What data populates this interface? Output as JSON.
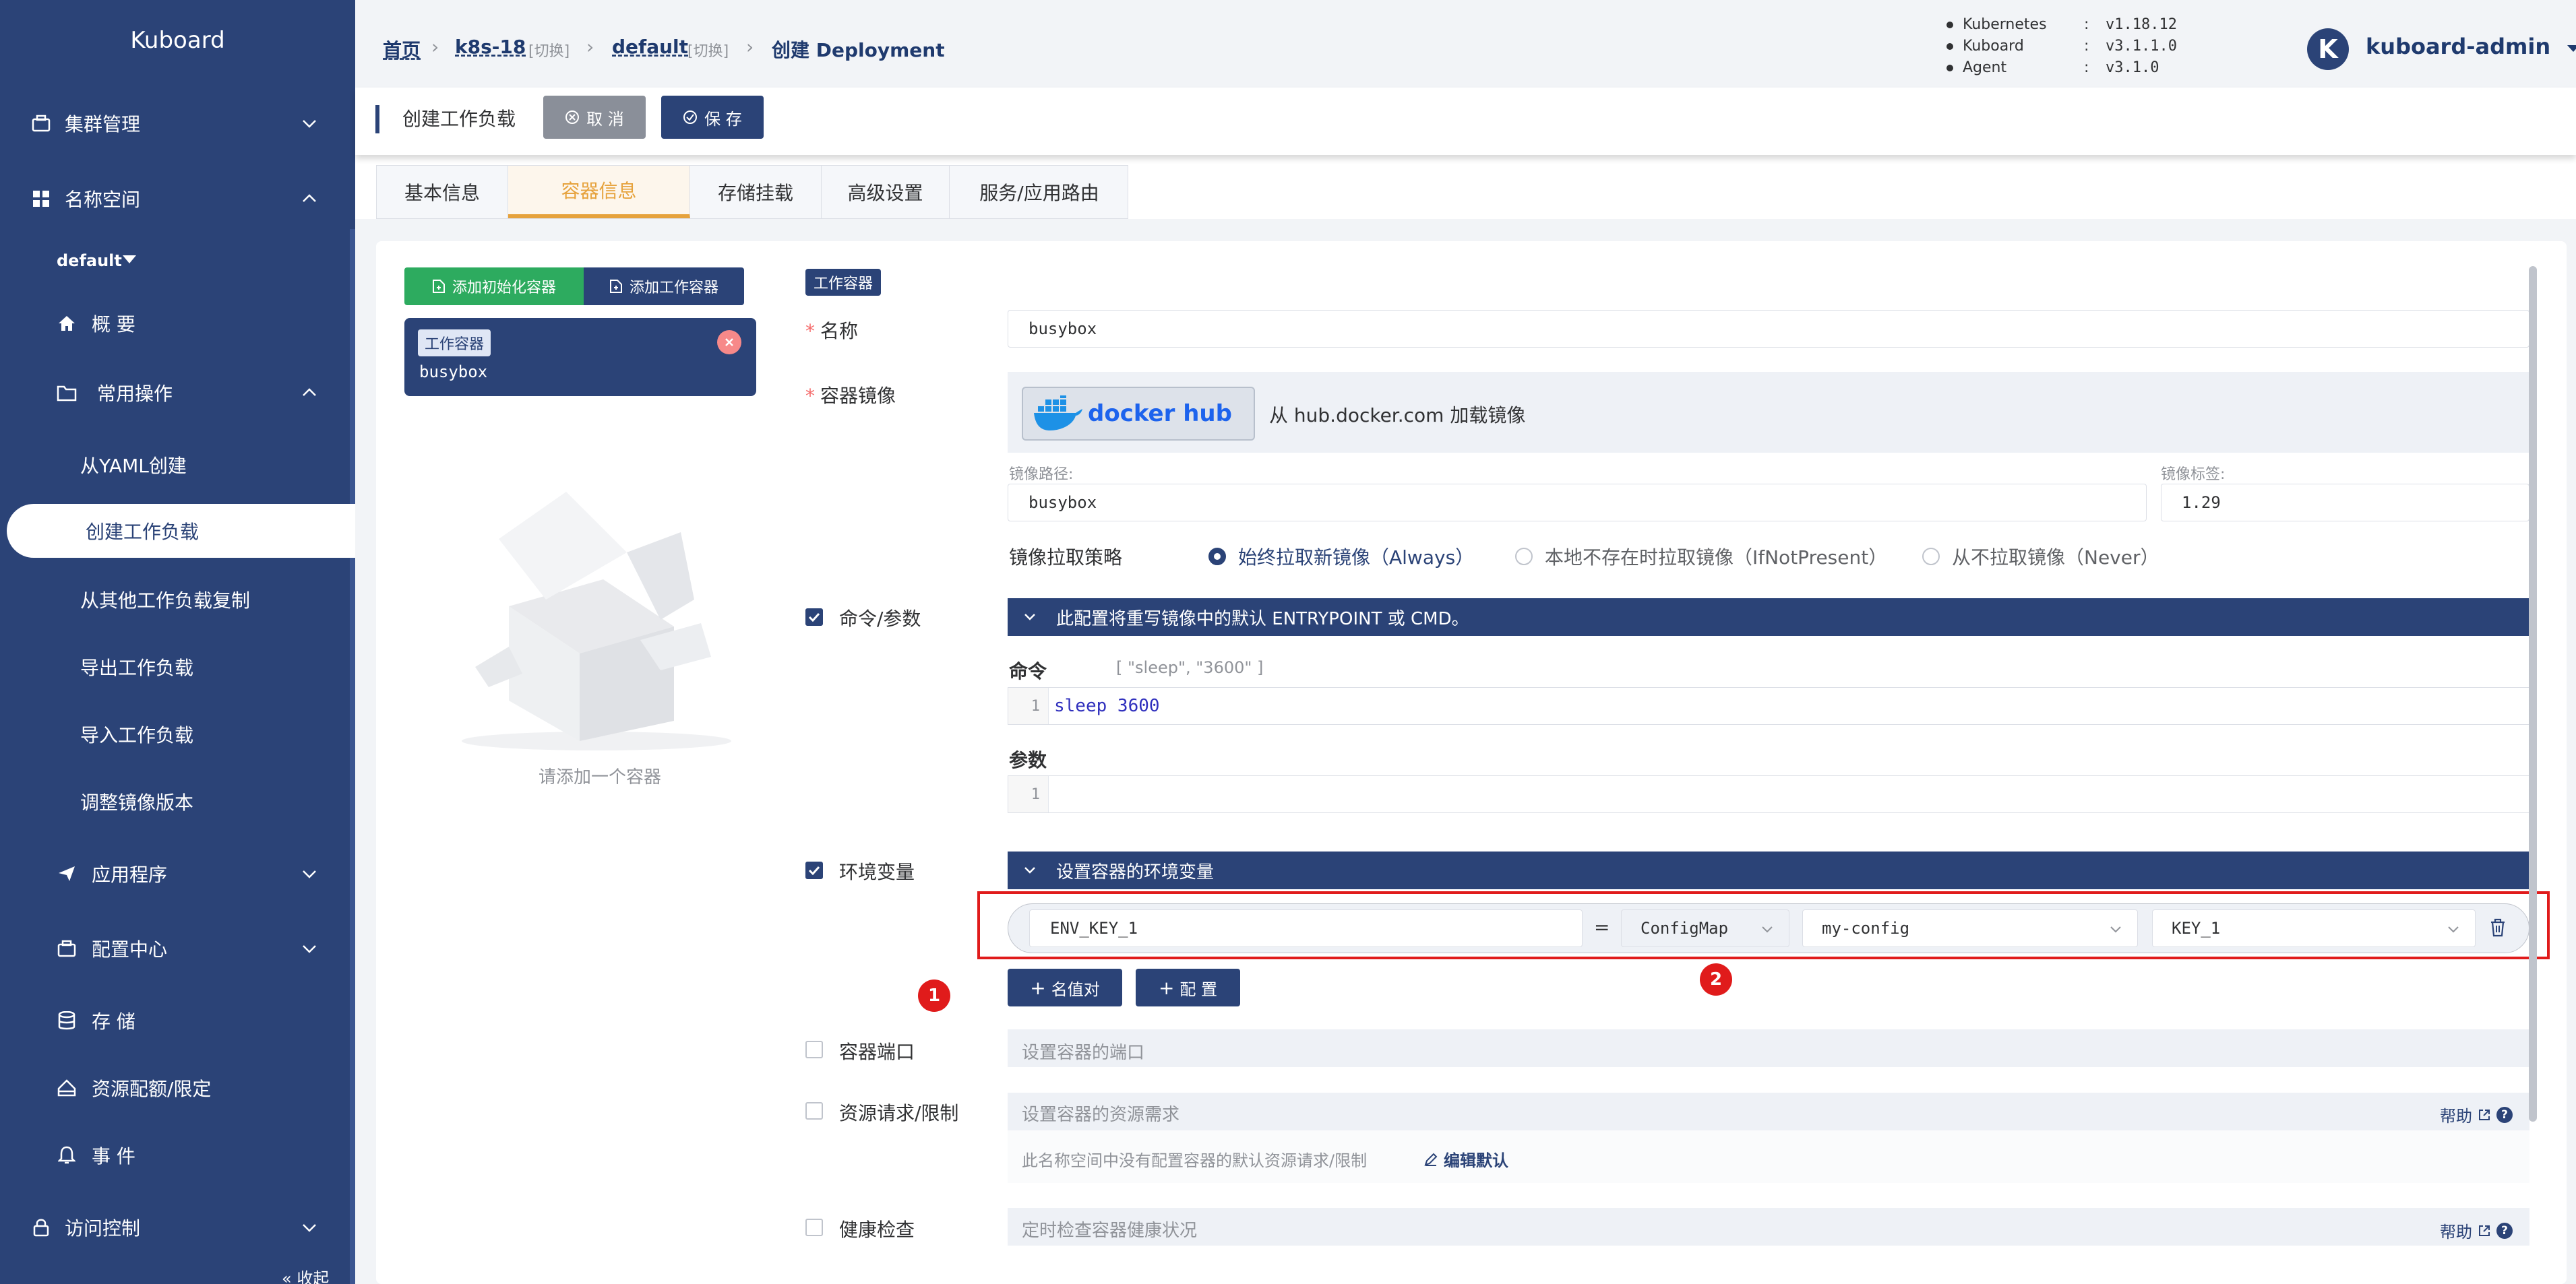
{
  "colors": {
    "primary": "#2b4377",
    "accent_orange": "#e6a23c",
    "green": "#2dab5f",
    "danger": "#e01b1b",
    "grey_bg": "#eef1f6"
  },
  "sidebar": {
    "logo": "Kuboard",
    "items": [
      {
        "label": "集群管理",
        "icon": "cluster-icon"
      },
      {
        "label": "名称空间",
        "icon": "grid-icon"
      },
      {
        "label": "default",
        "icon": "caret-down-icon"
      },
      {
        "label": "概 要",
        "icon": "home-icon"
      },
      {
        "label": "常用操作",
        "icon": "folder-icon"
      },
      {
        "label": "从YAML创建"
      },
      {
        "label": "创建工作负载"
      },
      {
        "label": "从其他工作负载复制"
      },
      {
        "label": "导出工作负载"
      },
      {
        "label": "导入工作负载"
      },
      {
        "label": "调整镜像版本"
      },
      {
        "label": "应用程序",
        "icon": "send-icon"
      },
      {
        "label": "配置中心",
        "icon": "config-icon"
      },
      {
        "label": "存 储",
        "icon": "database-icon"
      },
      {
        "label": "资源配额/限定",
        "icon": "quota-icon"
      },
      {
        "label": "事 件",
        "icon": "bell-icon"
      },
      {
        "label": "访问控制",
        "icon": "lock-icon"
      },
      {
        "label": "« 收起"
      }
    ]
  },
  "breadcrumb": {
    "home": "首页",
    "cluster": "k8s-18",
    "switch1": "[切换]",
    "namespace": "default",
    "switch2": "[切换]",
    "current": "创建 Deployment"
  },
  "versions": [
    {
      "name": "Kubernetes",
      "sep": ":",
      "value": "v1.18.12"
    },
    {
      "name": "Kuboard",
      "sep": ":",
      "value": "v3.1.1.0"
    },
    {
      "name": "Agent",
      "sep": ":",
      "value": "v3.1.0"
    }
  ],
  "user": {
    "avatar_letter": "K",
    "name": "kuboard-admin"
  },
  "header": {
    "title": "创建工作负载",
    "cancel": "取 消",
    "save": "保 存"
  },
  "tabs": [
    "基本信息",
    "容器信息",
    "存储挂载",
    "高级设置",
    "服务/应用路由"
  ],
  "left": {
    "add_init": "添加初始化容器",
    "add_work": "添加工作容器",
    "card_tag": "工作容器",
    "card_name": "busybox",
    "empty_text": "请添加一个容器"
  },
  "form": {
    "section_tag": "工作容器",
    "name_label": "名称",
    "name_value": "busybox",
    "image_label": "容器镜像",
    "dockerhub_text": "docker hub",
    "load_from": "从 hub.docker.com 加载镜像",
    "image_path_label": "镜像路径:",
    "image_path": "busybox",
    "image_tag_label": "镜像标签:",
    "image_tag": "1.29",
    "pull_policy_label": "镜像拉取策略",
    "pull_policies": [
      "始终拉取新镜像（Always）",
      "本地不存在时拉取镜像（IfNotPresent）",
      "从不拉取镜像（Never）"
    ],
    "pull_policy_selected": 0,
    "cmd_check_label": "命令/参数",
    "cmd_bar": "此配置将重写镜像中的默认 ENTRYPOINT 或 CMD。",
    "command_label": "命令",
    "command_hint": "[ \"sleep\", \"3600\" ]",
    "command_line_no": "1",
    "command_value": "sleep 3600",
    "args_label": "参数",
    "args_line_no": "1",
    "env_check_label": "环境变量",
    "env_bar": "设置容器的环境变量",
    "env_key": "ENV_KEY_1",
    "env_eq": "=",
    "env_source": "ConfigMap",
    "env_configmap": "my-config",
    "env_configkey": "KEY_1",
    "btn_add_pair": "名值对",
    "btn_add_config": "配 置",
    "badge1": "1",
    "badge2": "2",
    "port_label": "容器端口",
    "port_placeholder": "设置容器的端口",
    "resource_label": "资源请求/限制",
    "resource_placeholder": "设置容器的资源需求",
    "resource_help": "帮助",
    "resource_note": "此名称空间中没有配置容器的默认资源请求/限制",
    "resource_edit": "编辑默认",
    "health_label": "健康检查",
    "health_placeholder": "定时检查容器健康状况",
    "health_help": "帮助"
  }
}
